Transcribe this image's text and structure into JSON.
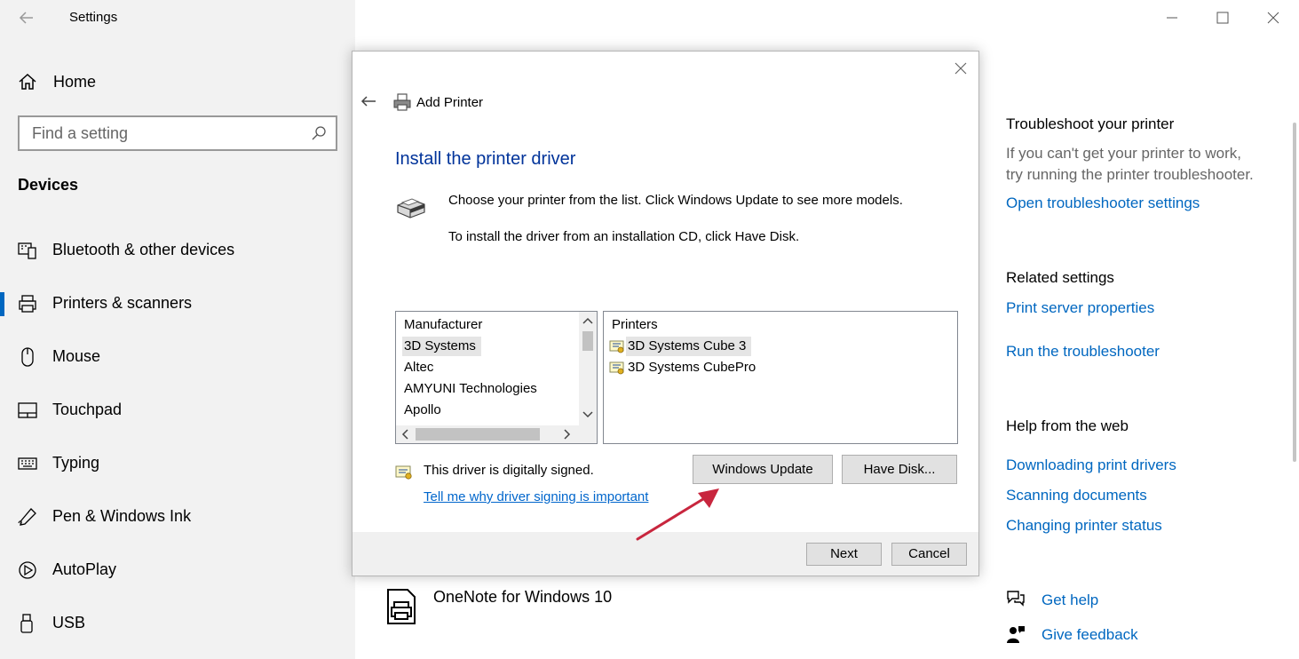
{
  "window": {
    "app_title": "Settings"
  },
  "sidebar": {
    "home_label": "Home",
    "search_placeholder": "Find a setting",
    "section": "Devices",
    "items": [
      {
        "label": "Bluetooth & other devices",
        "icon": "bluetooth-devices-icon"
      },
      {
        "label": "Printers & scanners",
        "icon": "printer-icon",
        "selected": true
      },
      {
        "label": "Mouse",
        "icon": "mouse-icon"
      },
      {
        "label": "Touchpad",
        "icon": "touchpad-icon"
      },
      {
        "label": "Typing",
        "icon": "keyboard-icon"
      },
      {
        "label": "Pen & Windows Ink",
        "icon": "pen-icon"
      },
      {
        "label": "AutoPlay",
        "icon": "autoplay-icon"
      },
      {
        "label": "USB",
        "icon": "usb-icon"
      }
    ]
  },
  "background": {
    "printer_name": "OneNote for Windows 10"
  },
  "right": {
    "troubleshoot": {
      "heading": "Troubleshoot your printer",
      "text1": "If you can't get your printer to work,",
      "text2": "try running the printer troubleshooter.",
      "link": "Open troubleshooter settings"
    },
    "related": {
      "heading": "Related settings",
      "links": [
        "Print server properties",
        "Run the troubleshooter"
      ]
    },
    "web": {
      "heading": "Help from the web",
      "links": [
        "Downloading print drivers",
        "Scanning documents",
        "Changing printer status"
      ]
    },
    "get_help": "Get help",
    "give_feedback": "Give feedback"
  },
  "dialog": {
    "title": "Add Printer",
    "heading": "Install the printer driver",
    "instruction1": "Choose your printer from the list. Click Windows Update to see more models.",
    "instruction2": "To install the driver from an installation CD, click Have Disk.",
    "manufacturer_header": "Manufacturer",
    "manufacturers": [
      "3D Systems",
      "Altec",
      "AMYUNI Technologies",
      "Apollo"
    ],
    "selected_manufacturer": "3D Systems",
    "printers_header": "Printers",
    "printers": [
      "3D Systems Cube 3",
      "3D Systems CubePro"
    ],
    "selected_printer": "3D Systems Cube 3",
    "signed_text": "This driver is digitally signed.",
    "signing_link": "Tell me why driver signing is important",
    "windows_update_button": "Windows Update",
    "have_disk_button": "Have Disk...",
    "next_button": "Next",
    "cancel_button": "Cancel"
  },
  "colors": {
    "accent": "#0067c0",
    "annotation_arrow": "#c8263e",
    "sidebar_bg": "#f2f2f2"
  }
}
